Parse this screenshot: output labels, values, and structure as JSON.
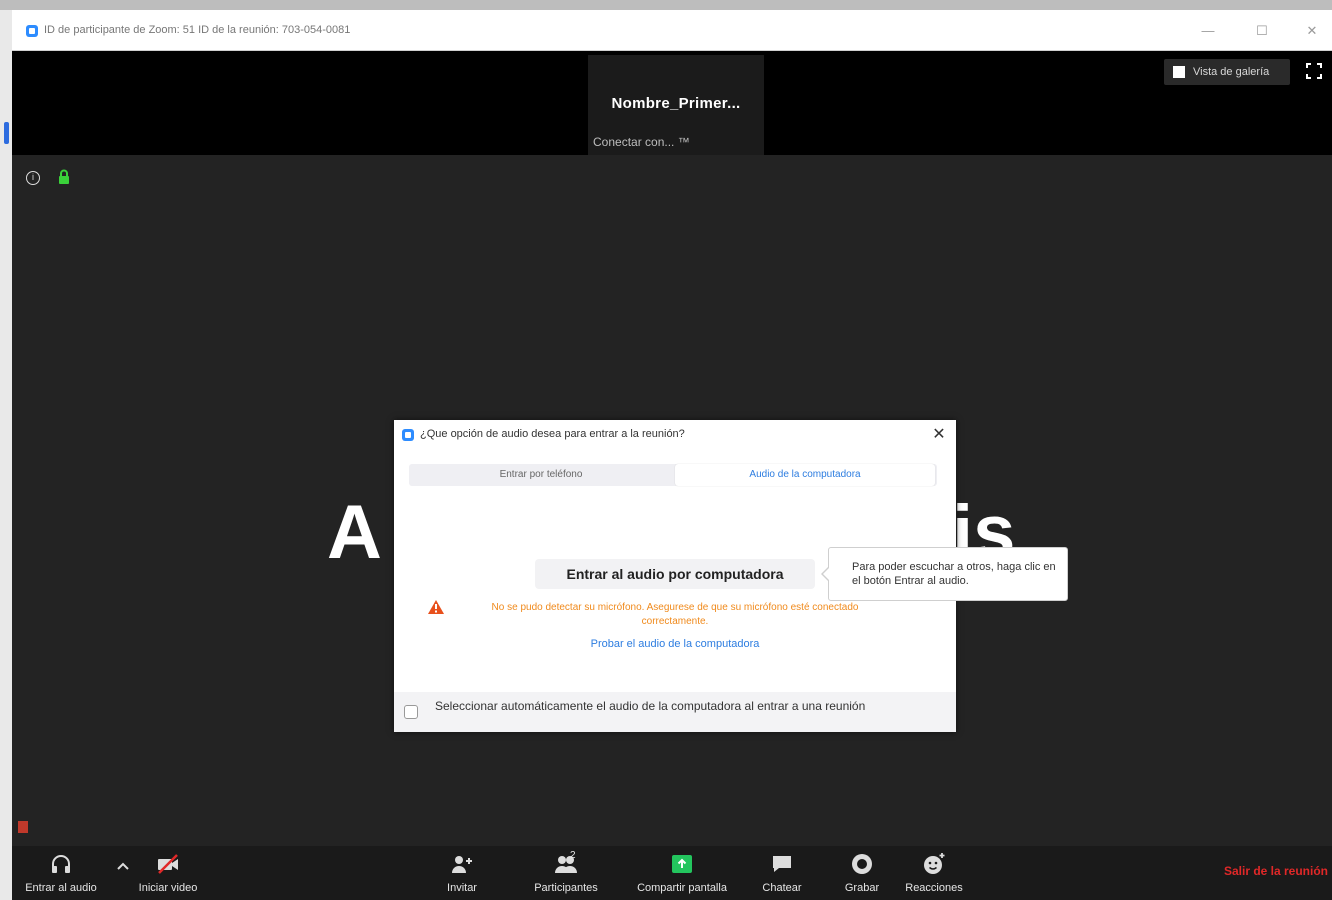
{
  "window": {
    "title": "ID de participante de Zoom: 51   ID de la reunión: 703-054-0081"
  },
  "speaker": {
    "name": "Nombre_Primer...",
    "status": "Conectar con... ™"
  },
  "view": {
    "gallery_label": "Vista de galería"
  },
  "background": {
    "text_left": "A",
    "text_right": "is"
  },
  "dialog": {
    "title": "¿Que opción de audio desea para entrar a la reunión?",
    "tabs": [
      {
        "label": "Entrar por teléfono"
      },
      {
        "label": "Audio de la computadora"
      }
    ],
    "join_button": "Entrar al audio por computadora",
    "warning": "No se pudo detectar su micrófono. Asegurese de que su micrófono esté conectado correctamente.",
    "test_link": "Probar el audio de la computadora",
    "auto_select_label": "Seleccionar automáticamente el audio de la computadora al entrar a una reunión"
  },
  "tooltip": {
    "text": "Para poder escuchar a otros, haga clic en el botón Entrar al audio."
  },
  "toolbar": {
    "audio": "Entrar al audio",
    "video": "Iniciar video",
    "invite": "Invitar",
    "participants": "Participantes",
    "participants_count": "2",
    "share": "Compartir pantalla",
    "chat": "Chatear",
    "record": "Grabar",
    "reactions": "Reacciones",
    "leave": "Salir de la reunión"
  },
  "colors": {
    "accent": "#2d8cff",
    "share_green": "#23c55e",
    "leave_red": "#e02828",
    "warning_orange": "#f08a1c",
    "lock_green": "#3ad13a"
  }
}
